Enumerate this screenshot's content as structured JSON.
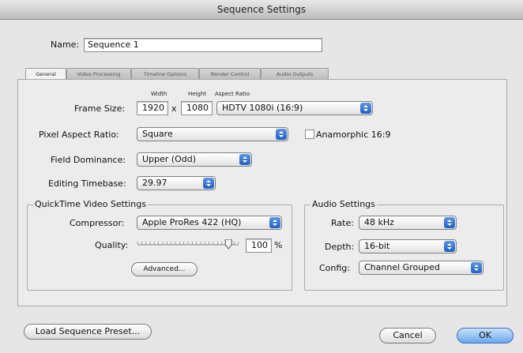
{
  "window": {
    "title": "Sequence Settings"
  },
  "name": {
    "label": "Name:",
    "value": "Sequence 1"
  },
  "tabs": [
    {
      "label": "General"
    },
    {
      "label": "Video Processing"
    },
    {
      "label": "Timeline Options"
    },
    {
      "label": "Render Control"
    },
    {
      "label": "Audio Outputs"
    }
  ],
  "frame_size": {
    "label": "Frame Size:",
    "width_caption": "Width",
    "height_caption": "Height",
    "aspect_caption": "Aspect Ratio",
    "width": "1920",
    "times": "x",
    "height": "1080",
    "aspect_ratio": "HDTV 1080i (16:9)"
  },
  "pixel_aspect": {
    "label": "Pixel Aspect Ratio:",
    "value": "Square"
  },
  "anamorphic": {
    "label": "Anamorphic 16:9",
    "checked": false
  },
  "field_dominance": {
    "label": "Field Dominance:",
    "value": "Upper (Odd)"
  },
  "editing_timebase": {
    "label": "Editing Timebase:",
    "value": "29.97"
  },
  "quicktime": {
    "title": "QuickTime Video Settings",
    "compressor_label": "Compressor:",
    "compressor": "Apple ProRes 422 (HQ)",
    "quality_label": "Quality:",
    "quality_value": "100",
    "quality_unit": "%",
    "quality_fraction": 0.9,
    "advanced_label": "Advanced..."
  },
  "audio": {
    "title": "Audio Settings",
    "rate_label": "Rate:",
    "rate": "48 kHz",
    "depth_label": "Depth:",
    "depth": "16-bit",
    "config_label": "Config:",
    "config": "Channel Grouped"
  },
  "buttons": {
    "load_preset": "Load Sequence Preset...",
    "cancel": "Cancel",
    "ok": "OK"
  }
}
